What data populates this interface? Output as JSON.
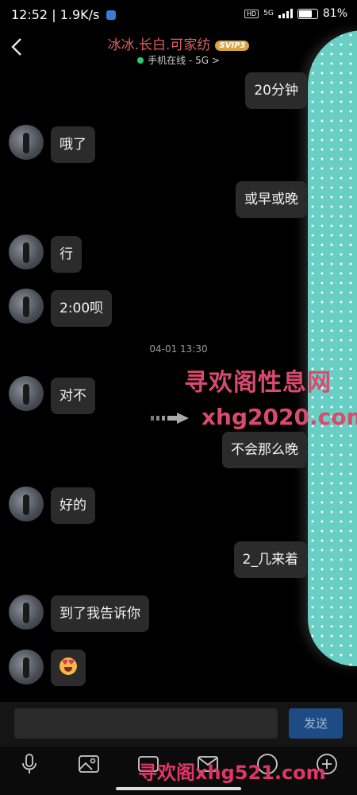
{
  "status_bar": {
    "time": "12:52",
    "speed": "1.9K/s",
    "hd": "HD",
    "network": "5G",
    "battery": "81%",
    "battery_level": 0.81
  },
  "header": {
    "title": "冰冰.长白.可家纺",
    "vip_badge": "SVIP3",
    "online_status": "手机在线 - 5G >"
  },
  "timestamp": "04-01 13:30",
  "messages": [
    {
      "side": "out",
      "text": "20分钟"
    },
    {
      "side": "in",
      "text": "哦了"
    },
    {
      "side": "out",
      "text": "或早或晚"
    },
    {
      "side": "in",
      "text": "行"
    },
    {
      "side": "in",
      "text": "2:00呗"
    },
    {
      "side": "in",
      "text": "对不"
    },
    {
      "side": "out",
      "text": "不会那么晚"
    },
    {
      "side": "in",
      "text": "好的"
    },
    {
      "side": "out",
      "text": "2_几来着"
    },
    {
      "side": "in",
      "text": "到了我告诉你"
    },
    {
      "side": "in",
      "text": "heart-eyes-emoji"
    }
  ],
  "watermark": {
    "line1": "寻欢阁性息网",
    "line2": "xhg2020.com",
    "bottom": "寻欢阁xhg521.com"
  },
  "composer": {
    "send_label": "发送"
  },
  "icons": [
    "back-icon",
    "phone-icon",
    "mic-icon",
    "image-icon",
    "video-icon",
    "mail-icon",
    "more-icon",
    "plus-icon"
  ],
  "colors": {
    "title": "#e06060",
    "bubble": "#2b2b2b",
    "send_button": "#1f4b84",
    "teal_decoration": "#69cfc4",
    "watermark": "#d94a6e"
  }
}
